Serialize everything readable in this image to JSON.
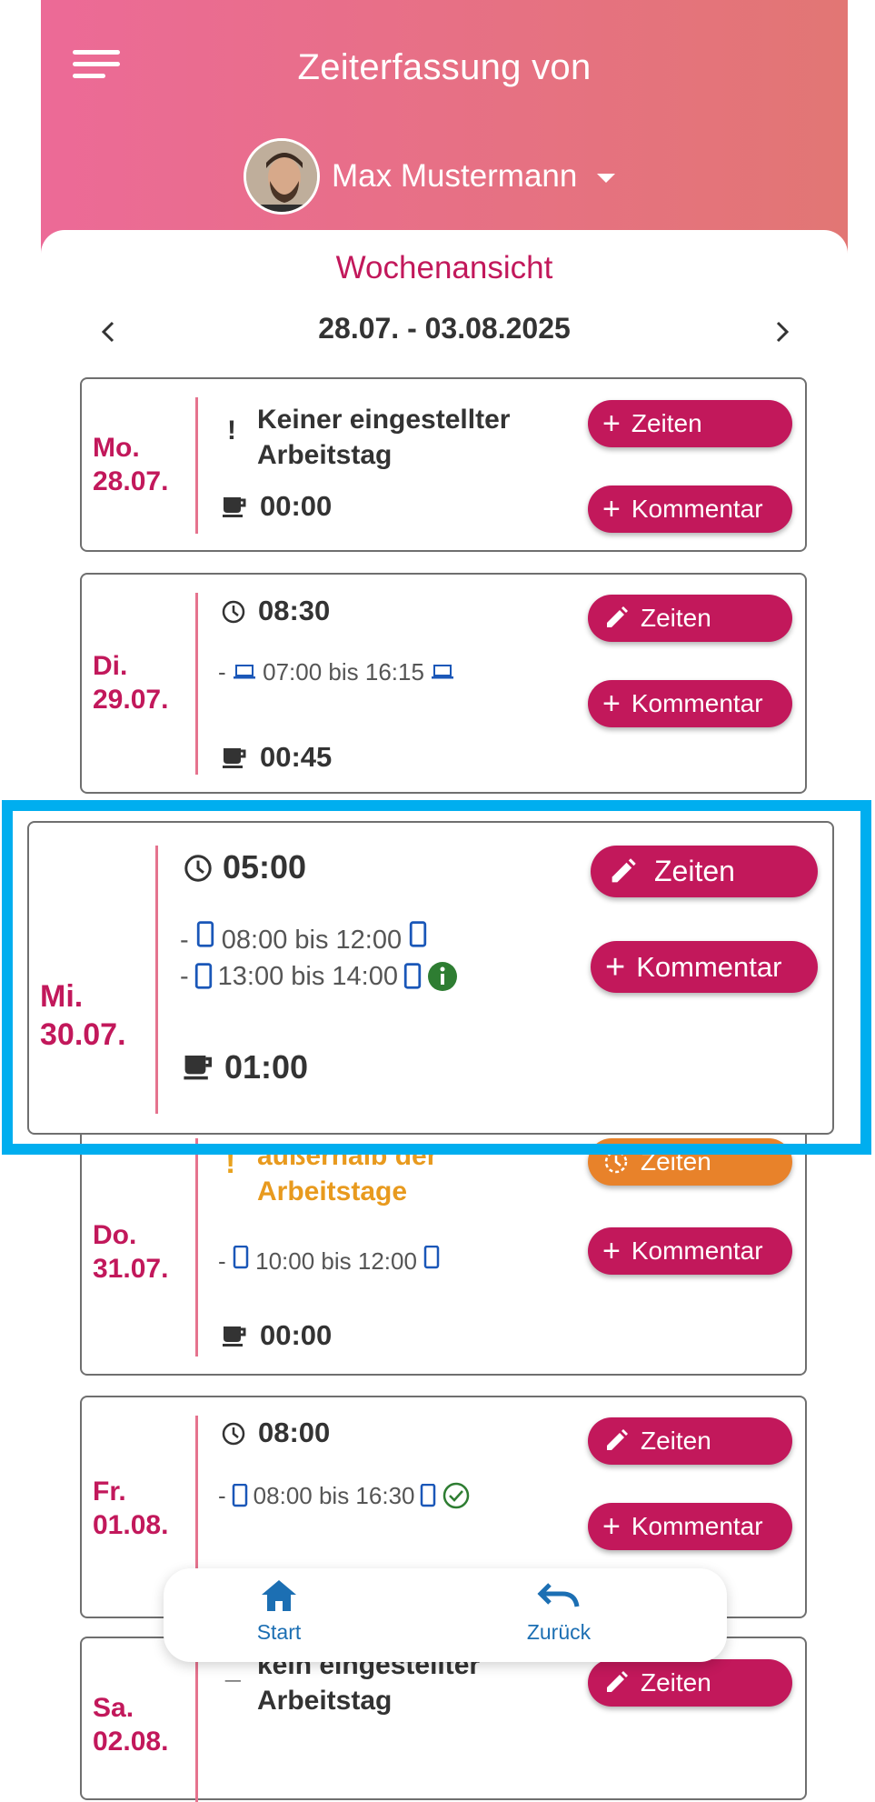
{
  "header": {
    "title": "Zeiterfassung von",
    "user_name": "Max Mustermann"
  },
  "week": {
    "title": "Wochenansicht",
    "range": "28.07. - 03.08.2025"
  },
  "days": [
    {
      "weekday": "Mo.",
      "date": "28.07.",
      "message_line1": "Keiner eingestellter",
      "message_line2": "Arbeitstag",
      "break": "00:00",
      "btn_times": "Zeiten",
      "btn_comment": "Kommentar"
    },
    {
      "weekday": "Di.",
      "date": "29.07.",
      "total": "08:30",
      "segment": "07:00 bis 16:15",
      "break": "00:45",
      "btn_times": "Zeiten",
      "btn_comment": "Kommentar"
    },
    {
      "weekday": "Mi.",
      "date": "30.07.",
      "total": "05:00",
      "segment1": "08:00 bis 12:00",
      "segment2": "13:00 bis 14:00",
      "break": "01:00",
      "btn_times": "Zeiten",
      "btn_comment": "Kommentar"
    },
    {
      "weekday": "Do.",
      "date": "31.07.",
      "message_line1": "außerhalb der",
      "message_line2": "Arbeitstage",
      "segment": "10:00 bis 12:00",
      "break": "00:00",
      "btn_times": "Zeiten",
      "btn_comment": "Kommentar"
    },
    {
      "weekday": "Fr.",
      "date": "01.08.",
      "total": "08:00",
      "segment": "08:00 bis 16:30",
      "btn_times": "Zeiten",
      "btn_comment": "Kommentar"
    },
    {
      "weekday": "Sa.",
      "date": "02.08.",
      "message_line1": "kein eingestellter",
      "message_line2": "Arbeitstag",
      "btn_times": "Zeiten"
    }
  ],
  "bottom_nav": {
    "start": "Start",
    "back": "Zurück"
  },
  "colors": {
    "header_gradient_start": "#ec6a97",
    "header_gradient_end": "#e27674",
    "accent": "#c2185b",
    "warning": "#e8822a",
    "device": "#1a57b8",
    "info": "#2e7d32",
    "highlight": "#00aeef"
  },
  "icons": [
    "menu-icon",
    "chevron-left-icon",
    "chevron-right-icon",
    "plus-icon",
    "pencil-icon",
    "clock-icon",
    "coffee-icon",
    "laptop-icon",
    "phone-icon",
    "info-icon",
    "check-circle-icon",
    "warning-icon",
    "home-icon",
    "undo-icon"
  ]
}
